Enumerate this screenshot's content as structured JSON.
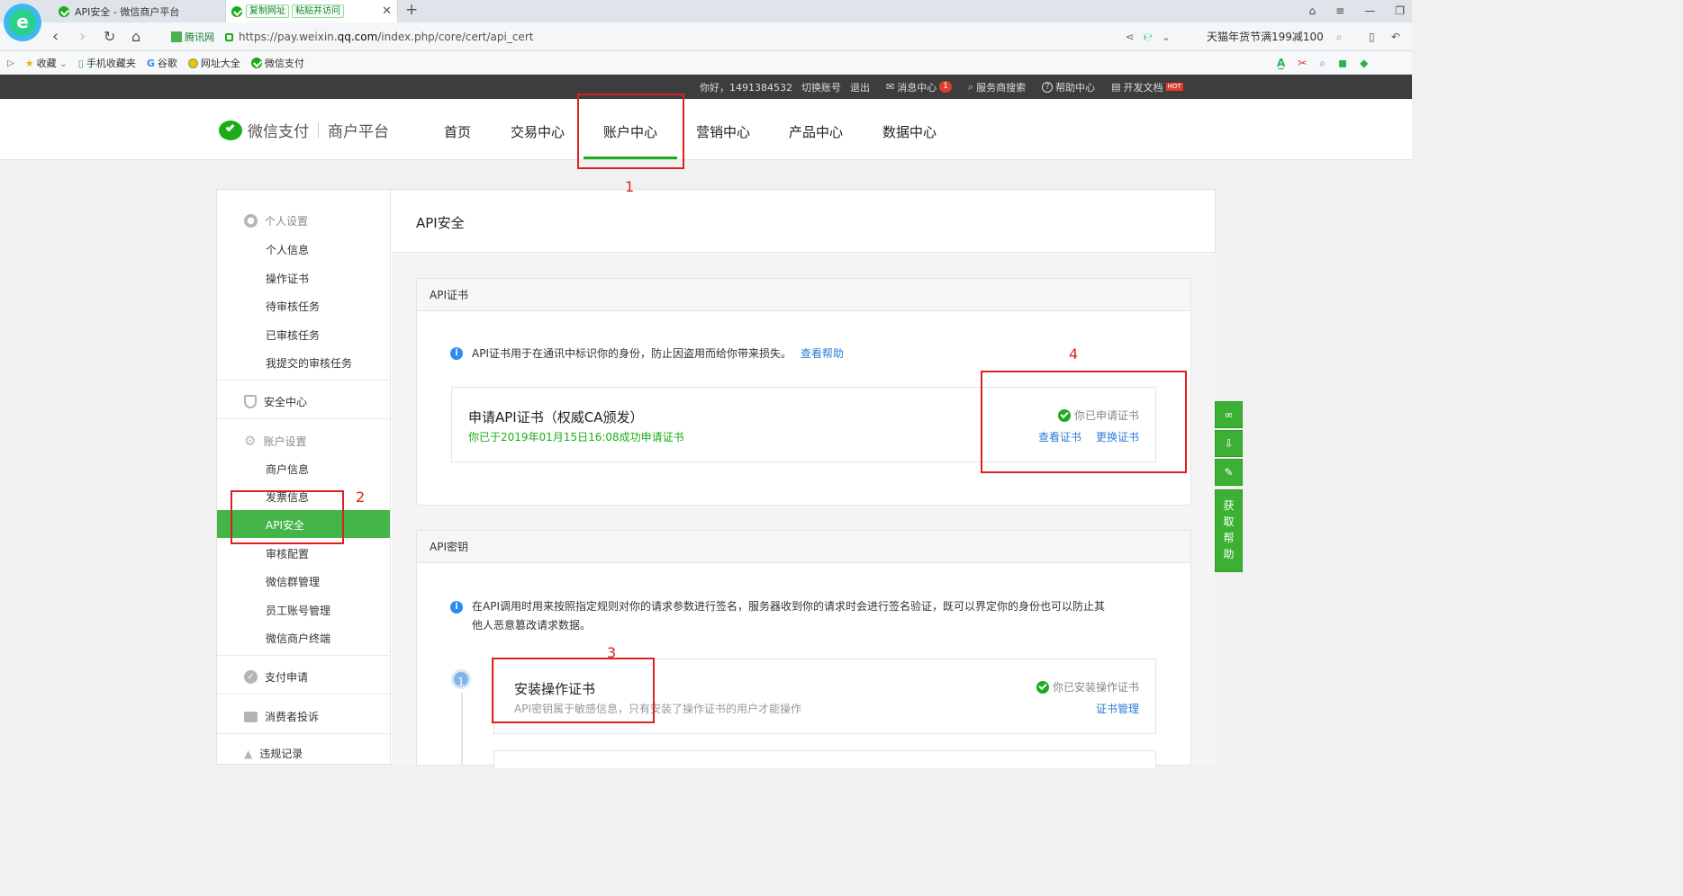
{
  "browser": {
    "tabs": [
      {
        "title": "API安全 - 微信商户平台"
      },
      {
        "title": "API安全 - 微信商户平台",
        "tools": [
          "复制网址",
          "粘贴并访问"
        ]
      }
    ],
    "new_tab": "+",
    "address": {
      "site_tag": "腾讯网",
      "url_prefix": "https://pay.weixin.",
      "url_domain": "qq.com",
      "url_path": "/index.php/core/cert/api_cert"
    },
    "promo": "天猫年货节满199减100",
    "bookmarks": [
      "收藏",
      "手机收藏夹",
      "谷歌",
      "网址大全",
      "微信支付"
    ]
  },
  "topbar": {
    "greeting": "你好，1491384532",
    "switch_account": "切换账号",
    "logout": "退出",
    "messages": "消息中心",
    "messages_count": "1",
    "search_provider": "服务商搜索",
    "help": "帮助中心",
    "dev_docs": "开发文档",
    "hot": "HOT"
  },
  "header": {
    "logo_brand": "微信支付",
    "logo_platform": "商户平台",
    "nav": [
      "首页",
      "交易中心",
      "账户中心",
      "营销中心",
      "产品中心",
      "数据中心"
    ],
    "active": "账户中心"
  },
  "sidebar": {
    "personal_group": "个人设置",
    "personal_items": [
      "个人信息",
      "操作证书",
      "待审核任务",
      "已审核任务",
      "我提交的审核任务"
    ],
    "security_center": "安全中心",
    "account_group": "账户设置",
    "account_items": [
      "商户信息",
      "发票信息",
      "API安全",
      "审核配置",
      "微信群管理",
      "员工账号管理",
      "微信商户终端"
    ],
    "pay_apply": "支付申请",
    "complaints": "消费者投诉",
    "violations": "违规记录"
  },
  "main": {
    "title": "API安全",
    "cert_section": {
      "head": "API证书",
      "info": "API证书用于在通讯中标识你的身份，防止因盗用而给你带来损失。",
      "help_link": "查看帮助",
      "box_title": "申请API证书（权威CA颁发）",
      "box_date": "你已于2019年01月15日16:08成功申请证书",
      "status": "你已申请证书",
      "view": "查看证书",
      "replace": "更换证书"
    },
    "key_section": {
      "head": "API密钥",
      "info_line1": "在API调用时用来按照指定规则对你的请求参数进行签名，服务器收到你的请求时会进行签名验证，既可以界定你的身份也可以防止其",
      "info_line2": "他人恶意篡改请求数据。",
      "step_num": "1",
      "step_title": "安装操作证书",
      "step_desc": "API密钥属于敏感信息，只有安装了操作证书的用户才能操作",
      "step_status": "你已安装操作证书",
      "step_link": "证书管理"
    }
  },
  "floating": {
    "help": [
      "获",
      "取",
      "帮",
      "助"
    ]
  },
  "annotations": [
    "1",
    "2",
    "3",
    "4"
  ],
  "colors": {
    "wechat_green": "#1aad19",
    "link_blue": "#2e7bd6",
    "annotation_red": "#e02020",
    "topbar": "#3d3d3d"
  }
}
